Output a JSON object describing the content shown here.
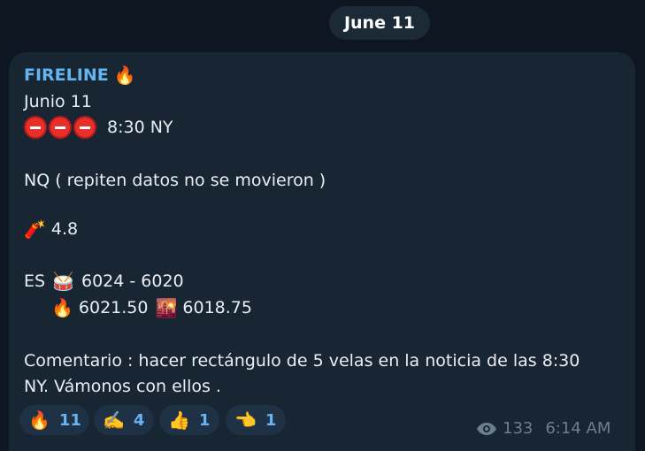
{
  "date_label": "June 11",
  "message": {
    "sender": "FIRELINE",
    "lines": {
      "l1": "Junio 11",
      "l2_time": "8:30 NY",
      "l3": "NQ ( repiten datos no se movieron )",
      "l4_value": "4.8",
      "l5_prefix": "ES",
      "l5_range": "6024 - 6020",
      "l6_a": "6021.50",
      "l6_b": "6018.75",
      "comment_1": "Comentario : hacer rectángulo de 5 velas en la noticia de las 8:30",
      "comment_2": "NY.  Vámonos con ellos ."
    }
  },
  "reactions": [
    {
      "icon": "fire-icon",
      "count": "11"
    },
    {
      "icon": "writing-hand-icon",
      "count": "4"
    },
    {
      "icon": "thumbs-up-icon",
      "count": "1"
    },
    {
      "icon": "pointing-hand-icon",
      "count": "1"
    }
  ],
  "views": "133",
  "time": "6:14 AM",
  "colors": {
    "background": "#0e1621",
    "bubble": "#182533",
    "accent": "#64b5ef",
    "reaction_bg": "#1f3144"
  }
}
